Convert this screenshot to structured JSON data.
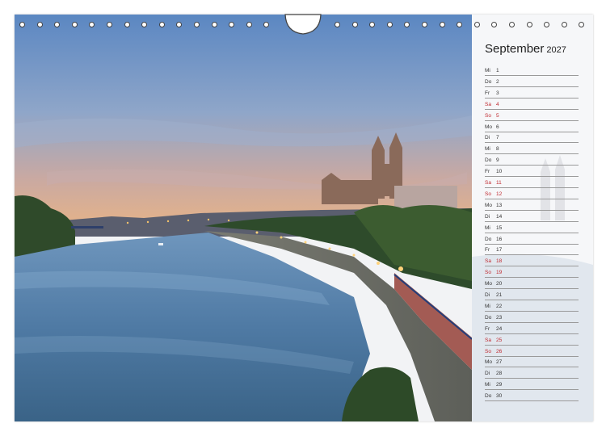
{
  "calendar": {
    "month": "September",
    "year": "2027",
    "days": [
      {
        "wd": "Mi",
        "d": "1",
        "we": false
      },
      {
        "wd": "Do",
        "d": "2",
        "we": false
      },
      {
        "wd": "Fr",
        "d": "3",
        "we": false
      },
      {
        "wd": "Sa",
        "d": "4",
        "we": true
      },
      {
        "wd": "So",
        "d": "5",
        "we": true
      },
      {
        "wd": "Mo",
        "d": "6",
        "we": false
      },
      {
        "wd": "Di",
        "d": "7",
        "we": false
      },
      {
        "wd": "Mi",
        "d": "8",
        "we": false
      },
      {
        "wd": "Do",
        "d": "9",
        "we": false
      },
      {
        "wd": "Fr",
        "d": "10",
        "we": false
      },
      {
        "wd": "Sa",
        "d": "11",
        "we": true
      },
      {
        "wd": "So",
        "d": "12",
        "we": true
      },
      {
        "wd": "Mo",
        "d": "13",
        "we": false
      },
      {
        "wd": "Di",
        "d": "14",
        "we": false
      },
      {
        "wd": "Mi",
        "d": "15",
        "we": false
      },
      {
        "wd": "Do",
        "d": "16",
        "we": false
      },
      {
        "wd": "Fr",
        "d": "17",
        "we": false
      },
      {
        "wd": "Sa",
        "d": "18",
        "we": true
      },
      {
        "wd": "So",
        "d": "19",
        "we": true
      },
      {
        "wd": "Mo",
        "d": "20",
        "we": false
      },
      {
        "wd": "Di",
        "d": "21",
        "we": false
      },
      {
        "wd": "Mi",
        "d": "22",
        "we": false
      },
      {
        "wd": "Do",
        "d": "23",
        "we": false
      },
      {
        "wd": "Fr",
        "d": "24",
        "we": false
      },
      {
        "wd": "Sa",
        "d": "25",
        "we": true
      },
      {
        "wd": "So",
        "d": "26",
        "we": true
      },
      {
        "wd": "Mo",
        "d": "27",
        "we": false
      },
      {
        "wd": "Di",
        "d": "28",
        "we": false
      },
      {
        "wd": "Mi",
        "d": "29",
        "we": false
      },
      {
        "wd": "Do",
        "d": "30",
        "we": false
      }
    ]
  },
  "colors": {
    "weekend": "#c0282e",
    "weekday": "#333333"
  }
}
